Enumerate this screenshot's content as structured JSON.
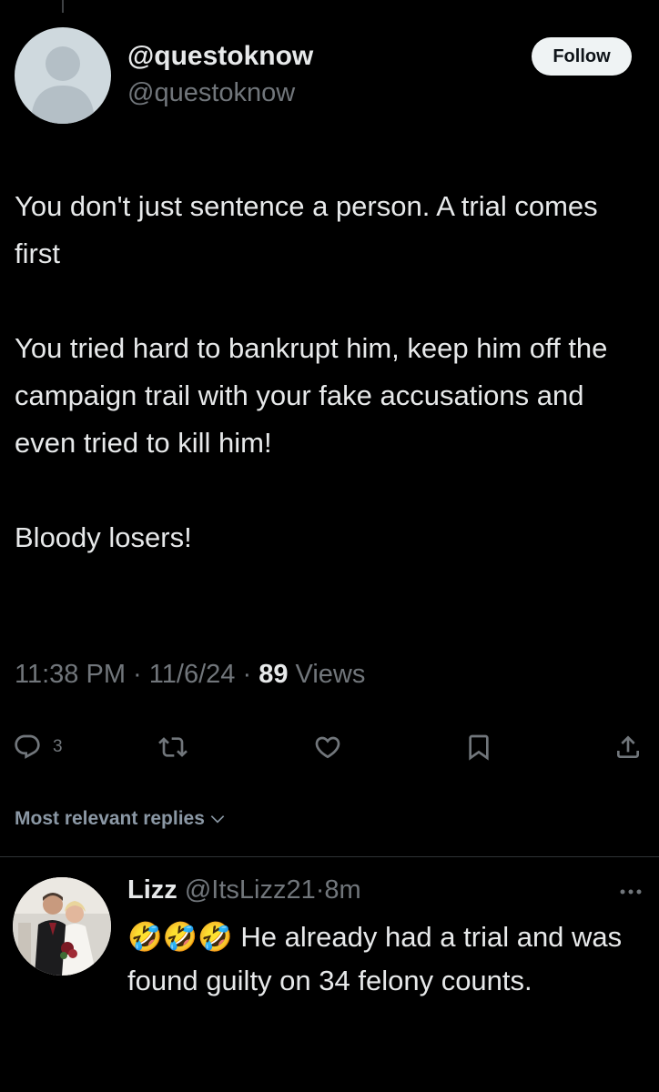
{
  "tweet": {
    "author": {
      "display_name": "@questoknow",
      "handle": "@questoknow"
    },
    "follow_label": "Follow",
    "paragraphs": [
      "You don't just sentence a person. A trial comes first",
      "You tried hard to bankrupt him, keep him off the campaign trail with your fake accusations and even tried to kill him!",
      "Bloody losers!"
    ],
    "time": "11:38 PM",
    "date": "11/6/24",
    "views_count": "89",
    "views_label": "Views",
    "separator": "·",
    "actions": {
      "reply_count": "3"
    }
  },
  "icons": {
    "reply": "reply-icon",
    "retweet": "retweet-icon",
    "like": "heart-icon",
    "bookmark": "bookmark-icon",
    "share": "share-icon",
    "chevron": "chevron-down-icon",
    "more": "more-icon"
  },
  "replies_sort": {
    "label": "Most relevant replies"
  },
  "reply": {
    "name": "Lizz",
    "handle": "@ItsLizz21",
    "separator": "·",
    "time": "8m",
    "emoji": "🤣🤣🤣",
    "text": "He already had a trial and was found guilty on 34 felony counts."
  },
  "colors": {
    "background": "#000000",
    "text_primary": "#e7e9ea",
    "text_secondary": "#71767b",
    "follow_button_bg": "#eff3f4",
    "divider": "#2f3336"
  }
}
